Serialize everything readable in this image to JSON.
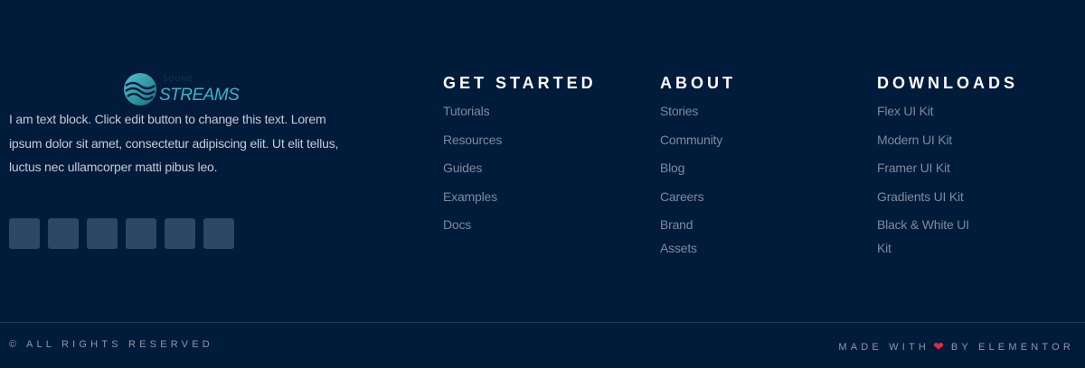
{
  "logo": {
    "name": "STREAMS",
    "tagline": "SOUND"
  },
  "about_text": "I am text block. Click edit button to change this text. Lorem ipsum dolor sit amet, consectetur adipiscing elit. Ut elit tellus, luctus nec ullamcorper matti pibus leo.",
  "social_icons": [
    "social-icon",
    "social-icon",
    "social-icon",
    "social-icon",
    "social-icon",
    "social-icon"
  ],
  "columns": [
    {
      "title": "GET STARTED",
      "links": [
        "Tutorials",
        "Resources",
        "Guides",
        "Examples",
        "Docs"
      ]
    },
    {
      "title": "ABOUT",
      "links": [
        "Stories",
        "Community",
        "Blog",
        "Careers",
        "Brand Assets"
      ]
    },
    {
      "title": "DOWNLOADS",
      "links": [
        "Flex UI Kit",
        "Modern UI Kit",
        "Framer UI Kit",
        "Gradients UI Kit",
        "Black & White UI Kit"
      ]
    }
  ],
  "bottom": {
    "copyright": "© ALL RIGHTS RESERVED",
    "made_with": "MADE WITH",
    "by": "BY ELEMENTOR"
  },
  "colors": {
    "background": "#011b3a",
    "accent": "#3eb5c6",
    "heart": "#e02b46"
  }
}
